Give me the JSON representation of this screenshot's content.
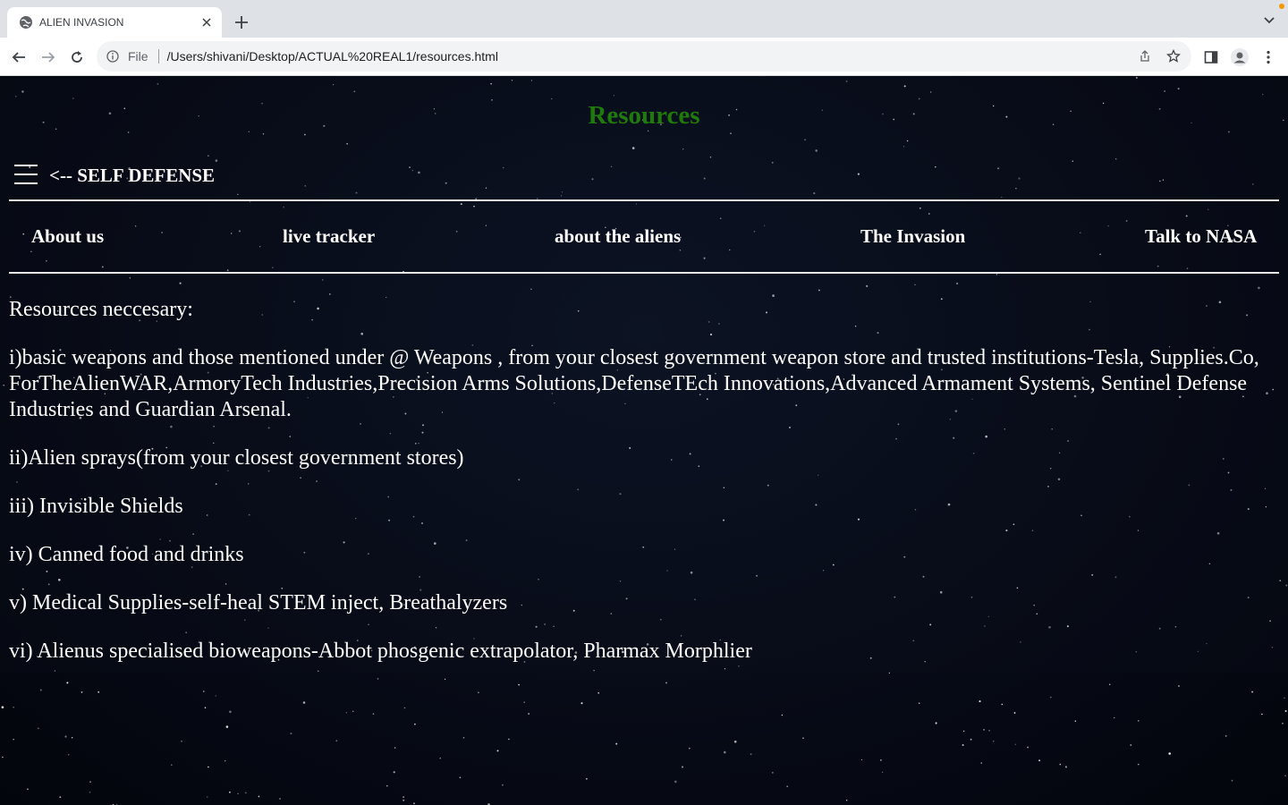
{
  "browser": {
    "tab_title": "ALIEN INVASION",
    "address_scheme": "File",
    "address_url": "/Users/shivani/Desktop/ACTUAL%20REAL1/resources.html"
  },
  "page": {
    "title": "Resources",
    "title_color": "#1f7a0c",
    "self_defense_link": "<-- SELF DEFENSE",
    "nav": [
      "About us",
      "live tracker",
      "about the aliens",
      "The Invasion",
      "Talk to NASA"
    ],
    "heading": "Resources neccesary:",
    "items": [
      "i)basic weapons and those mentioned under @ Weapons , from your closest government weapon store and trusted institutions-Tesla, Supplies.Co, ForTheAlienWAR,ArmoryTech Industries,Precision Arms Solutions,DefenseTEch Innovations,Advanced Armament Systems, Sentinel Defense Industries and Guardian Arsenal.",
      "ii)Alien sprays(from your closest government stores)",
      "iii) Invisible Shields",
      "iv) Canned food and drinks",
      "v) Medical Supplies-self-heal STEM inject, Breathalyzers",
      "vi) Alienus specialised bioweapons-Abbot phosgenic extrapolator, Pharmax Morphlier"
    ]
  }
}
